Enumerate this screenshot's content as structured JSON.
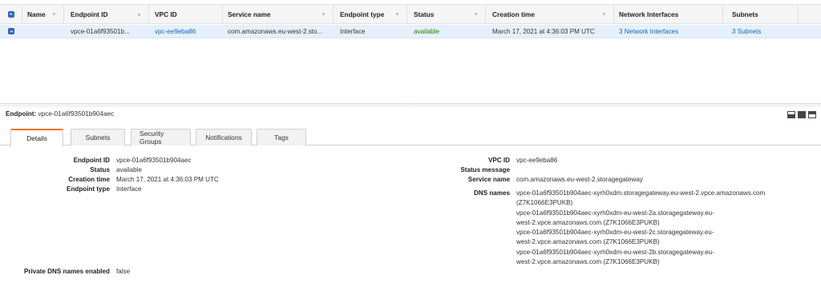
{
  "grid": {
    "columns": [
      {
        "label": "Name",
        "sort": "▾"
      },
      {
        "label": "Endpoint ID",
        "sort": "▴"
      },
      {
        "label": "VPC ID",
        "sort": ""
      },
      {
        "label": "Service name",
        "sort": "▾"
      },
      {
        "label": "Endpoint type",
        "sort": "▾"
      },
      {
        "label": "Status",
        "sort": "▾"
      },
      {
        "label": "Creation time",
        "sort": "▾"
      },
      {
        "label": "Network Interfaces",
        "sort": ""
      },
      {
        "label": "Subnets",
        "sort": ""
      }
    ],
    "rows": [
      {
        "name": "",
        "endpoint_id": "vpce-01a6f93501b...",
        "vpc_id": "vpc-ee9eba86",
        "service_name": "com.amazonaws.eu-west-2.sto...",
        "endpoint_type": "Interface",
        "status": "available",
        "creation_time": "March 17, 2021 at 4:36:03 PM UTC",
        "network_interfaces": "3 Network Interfaces",
        "subnets": "3 Subnets"
      }
    ]
  },
  "detail": {
    "title_label": "Endpoint:",
    "title_value": "vpce-01a6f93501b904aec",
    "tabs": [
      "Details",
      "Subnets",
      "Security Groups",
      "Notifications",
      "Tags"
    ],
    "left": [
      {
        "label": "Endpoint ID",
        "value": "vpce-01a6f93501b904aec"
      },
      {
        "label": "Status",
        "value": "available"
      },
      {
        "label": "Creation time",
        "value": "March 17, 2021 at 4:36:03 PM UTC"
      },
      {
        "label": "Endpoint type",
        "value": "Interface"
      }
    ],
    "private_dns": {
      "label": "Private DNS names enabled",
      "value": "false"
    },
    "right": [
      {
        "label": "VPC ID",
        "value": "vpc-ee9eba86"
      },
      {
        "label": "Status message",
        "value": ""
      },
      {
        "label": "Service name",
        "value": "com.amazonaws.eu-west-2.storagegateway"
      },
      {
        "label": "DNS names",
        "value": ""
      }
    ],
    "dns_lines": [
      "vpce-01a6f93501b904aec-xyrh0xdm.storagegateway.eu-west-2.vpce.amazonaws.com",
      "(Z7K1066E3PUKB)",
      "vpce-01a6f93501b904aec-xyrh0xdm-eu-west-2a.storagegateway.eu-",
      "west-2.vpce.amazonaws.com (Z7K1066E3PUKB)",
      "vpce-01a6f93501b904aec-xyrh0xdm-eu-west-2c.storagegateway.eu-",
      "west-2.vpce.amazonaws.com (Z7K1066E3PUKB)",
      "vpce-01a6f93501b904aec-xyrh0xdm-eu-west-2b.storagegateway.eu-",
      "west-2.vpce.amazonaws.com (Z7K1066E3PUKB)"
    ]
  },
  "colors": {
    "link": "#1166bb",
    "status_ok": "#1d8102",
    "tab_accent": "#ec7211",
    "row_selected": "#e6f0fb"
  }
}
